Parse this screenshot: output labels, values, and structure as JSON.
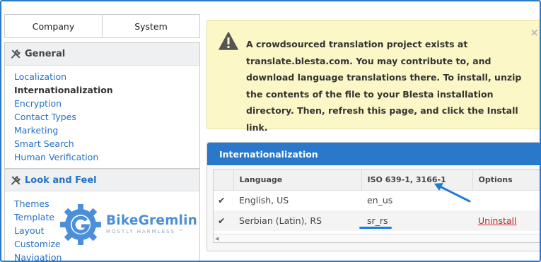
{
  "sidebar": {
    "tabs": [
      {
        "label": "Company"
      },
      {
        "label": "System"
      }
    ],
    "general": {
      "title": "General",
      "icon": "wrench-screwdriver-icon",
      "items": [
        {
          "label": "Localization"
        },
        {
          "label": "Internationalization"
        },
        {
          "label": "Encryption"
        },
        {
          "label": "Contact Types"
        },
        {
          "label": "Marketing"
        },
        {
          "label": "Smart Search"
        },
        {
          "label": "Human Verification"
        }
      ]
    },
    "look_and_feel": {
      "title": "Look and Feel",
      "icon": "wrench-screwdriver-icon",
      "items": [
        {
          "label": "Themes"
        },
        {
          "label": "Template"
        },
        {
          "label": "Layout"
        },
        {
          "label": "Customize"
        },
        {
          "label": "Navigation"
        }
      ]
    }
  },
  "logo": {
    "name_part1": "Bike",
    "name_part2": "Gremlin",
    "tagline": "MOSTLY HARMLESS ™"
  },
  "alert": {
    "icon": "warning-triangle-icon",
    "text": "A crowdsourced translation project exists at translate.blesta.com. You may contribute to, and download language translations there. To install, unzip the contents of the file to your Blesta installation directory. Then, refresh this page, and click the Install link.",
    "close": "×"
  },
  "panel": {
    "title": "Internationalization",
    "columns": [
      "",
      "Language",
      "ISO 639-1, 3166-1",
      "Options"
    ],
    "rows": [
      {
        "check": "✔",
        "language": "English, US",
        "code": "en_us",
        "option": ""
      },
      {
        "check": "✔",
        "language": "Serbian (Latin), RS",
        "code": "sr_rs",
        "option": "Uninstall"
      }
    ]
  },
  "colors": {
    "accent": "#2a78c9",
    "link": "#2571c6",
    "alert_bg": "#fbf7c7",
    "uninstall": "#c02525"
  }
}
